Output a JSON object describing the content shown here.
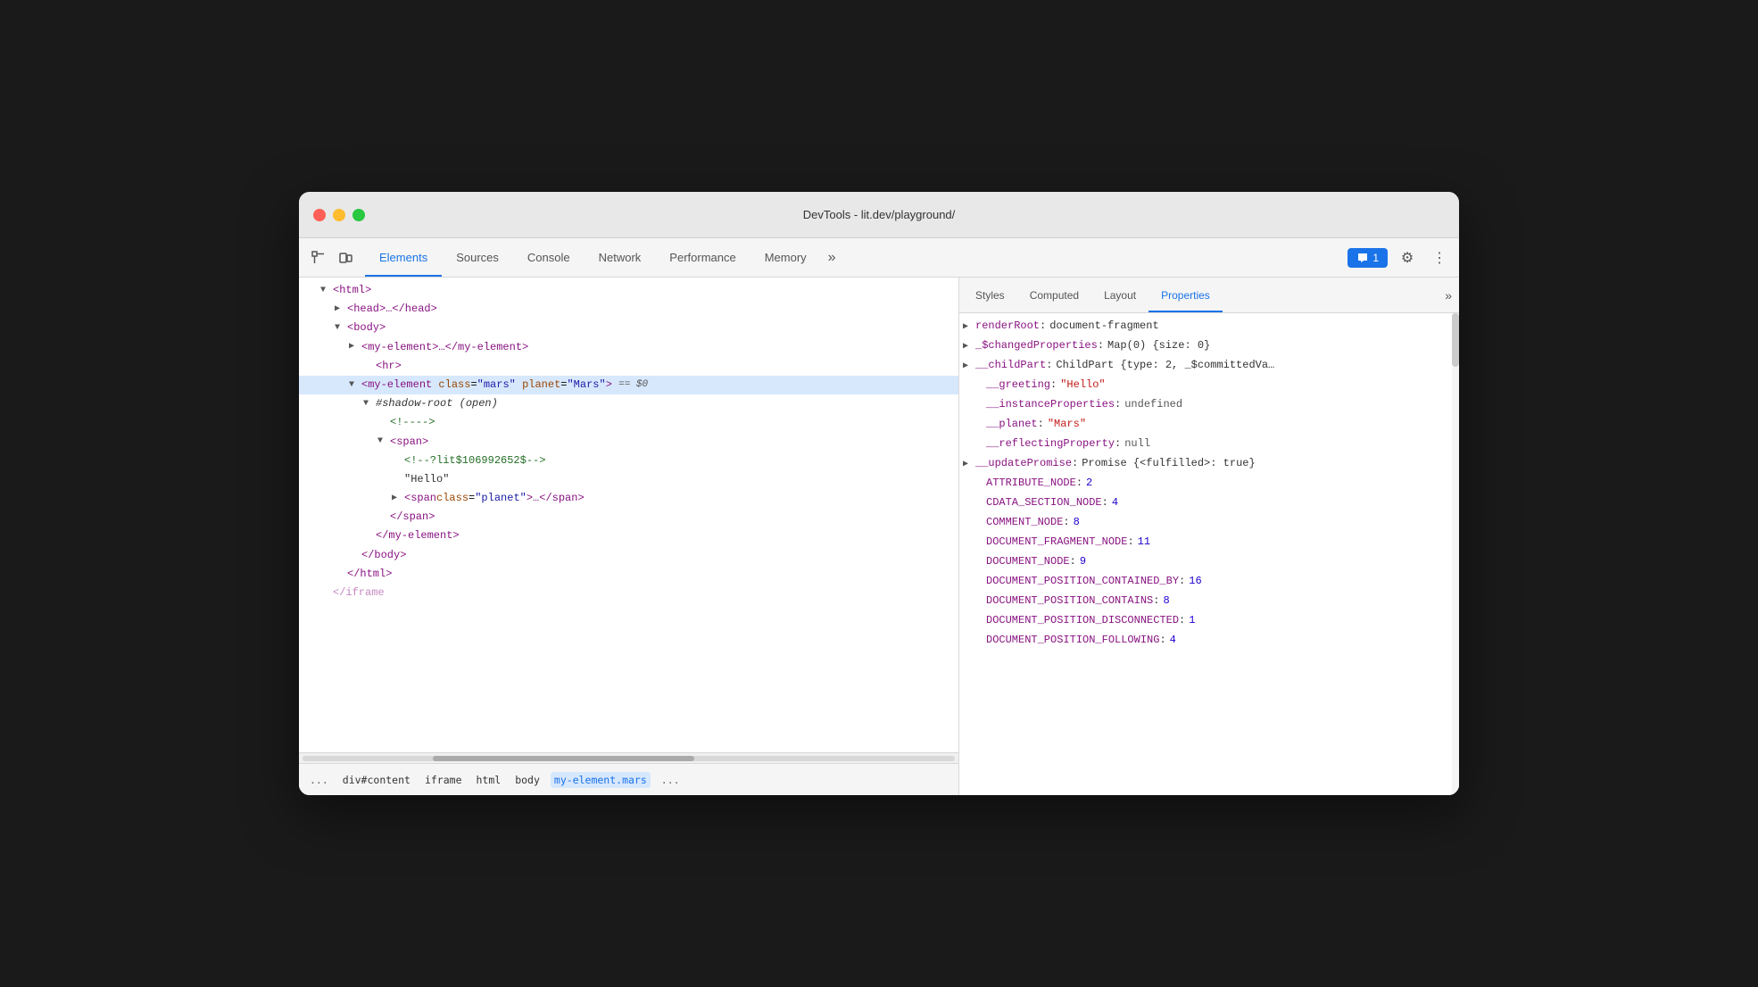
{
  "window": {
    "title": "DevTools - lit.dev/playground/"
  },
  "toolbar": {
    "tabs": [
      {
        "id": "elements",
        "label": "Elements",
        "active": true
      },
      {
        "id": "sources",
        "label": "Sources",
        "active": false
      },
      {
        "id": "console",
        "label": "Console",
        "active": false
      },
      {
        "id": "network",
        "label": "Network",
        "active": false
      },
      {
        "id": "performance",
        "label": "Performance",
        "active": false
      },
      {
        "id": "memory",
        "label": "Memory",
        "active": false
      }
    ],
    "more_tabs": "»",
    "chat_label": "1",
    "settings_icon": "⚙",
    "more_icon": "⋮"
  },
  "right_panel": {
    "tabs": [
      {
        "id": "styles",
        "label": "Styles",
        "active": false
      },
      {
        "id": "computed",
        "label": "Computed",
        "active": false
      },
      {
        "id": "layout",
        "label": "Layout",
        "active": false
      },
      {
        "id": "properties",
        "label": "Properties",
        "active": true
      }
    ],
    "more_icon": "»"
  },
  "dom_tree": {
    "lines": [
      {
        "indent": 1,
        "triangle": "▼",
        "content": "<html>",
        "type": "tag",
        "selected": false
      },
      {
        "indent": 2,
        "triangle": "▶",
        "content": "<head>…</head>",
        "type": "tag",
        "selected": false
      },
      {
        "indent": 2,
        "triangle": "▼",
        "content": "<body>",
        "type": "tag",
        "selected": false
      },
      {
        "indent": 3,
        "triangle": "▶",
        "content": "<my-element>…</my-element>",
        "type": "tag",
        "selected": false
      },
      {
        "indent": 4,
        "triangle": "",
        "content": "<hr>",
        "type": "tag",
        "selected": false
      },
      {
        "indent": 3,
        "triangle": "▼",
        "content_parts": true,
        "selected": true,
        "id": "selected-line"
      },
      {
        "indent": 4,
        "triangle": "▼",
        "content": "#shadow-root (open)",
        "type": "shadow",
        "selected": false
      },
      {
        "indent": 5,
        "triangle": "",
        "content": "<!---->",
        "type": "comment",
        "selected": false
      },
      {
        "indent": 5,
        "triangle": "▼",
        "content": "<span>",
        "type": "tag",
        "selected": false
      },
      {
        "indent": 6,
        "triangle": "",
        "content": "<!--?lit$106992652$-->",
        "type": "comment",
        "selected": false
      },
      {
        "indent": 6,
        "triangle": "",
        "content": "\"Hello\"",
        "type": "text",
        "selected": false
      },
      {
        "indent": 6,
        "triangle": "▶",
        "content": "<span class=\"planet\">…</span>",
        "type": "tag",
        "selected": false
      },
      {
        "indent": 5,
        "triangle": "",
        "content": "</span>",
        "type": "tag-close",
        "selected": false
      },
      {
        "indent": 4,
        "triangle": "",
        "content": "</my-element>",
        "type": "tag-close",
        "selected": false
      },
      {
        "indent": 3,
        "triangle": "",
        "content": "</body>",
        "type": "tag-close",
        "selected": false
      },
      {
        "indent": 2,
        "triangle": "",
        "content": "</html>",
        "type": "tag-close",
        "selected": false
      },
      {
        "indent": 1,
        "triangle": "",
        "content": "</iframe>",
        "type": "tag-close-fade",
        "selected": false
      }
    ]
  },
  "selected_element": {
    "tag_open": "<",
    "tag_name": "my-element",
    "attr_class_name": "class",
    "attr_class_val": "\"mars\"",
    "attr_planet_name": "planet",
    "attr_planet_val": "\"Mars\"",
    "tag_close": ">",
    "dollar": "== $0"
  },
  "breadcrumb": {
    "items": [
      {
        "label": "...",
        "active": false
      },
      {
        "label": "div#content",
        "active": false
      },
      {
        "label": "iframe",
        "active": false
      },
      {
        "label": "html",
        "active": false
      },
      {
        "label": "body",
        "active": false
      },
      {
        "label": "my-element.mars",
        "active": true
      }
    ],
    "more": "..."
  },
  "properties": [
    {
      "expandable": true,
      "name": "renderRoot",
      "colon": ":",
      "value": "document-fragment",
      "value_type": "object"
    },
    {
      "expandable": true,
      "name": "_$changedProperties",
      "colon": ":",
      "value": "Map(0) {size: 0}",
      "value_type": "object"
    },
    {
      "expandable": true,
      "name": "__childPart",
      "colon": ":",
      "value": "ChildPart {type: 2, _$committedVa…",
      "value_type": "object"
    },
    {
      "expandable": false,
      "name": "__greeting",
      "colon": ":",
      "value": "\"Hello\"",
      "value_type": "string"
    },
    {
      "expandable": false,
      "name": "__instanceProperties",
      "colon": ":",
      "value": "undefined",
      "value_type": "null-val"
    },
    {
      "expandable": false,
      "name": "__planet",
      "colon": ":",
      "value": "\"Mars\"",
      "value_type": "string"
    },
    {
      "expandable": false,
      "name": "__reflectingProperty",
      "colon": ":",
      "value": "null",
      "value_type": "null-val"
    },
    {
      "expandable": true,
      "name": "__updatePromise",
      "colon": ":",
      "value": "Promise {<fulfilled>: true}",
      "value_type": "object"
    },
    {
      "expandable": false,
      "name": "ATTRIBUTE_NODE",
      "colon": ":",
      "value": "2",
      "value_type": "number"
    },
    {
      "expandable": false,
      "name": "CDATA_SECTION_NODE",
      "colon": ":",
      "value": "4",
      "value_type": "number"
    },
    {
      "expandable": false,
      "name": "COMMENT_NODE",
      "colon": ":",
      "value": "8",
      "value_type": "number"
    },
    {
      "expandable": false,
      "name": "DOCUMENT_FRAGMENT_NODE",
      "colon": ":",
      "value": "11",
      "value_type": "number"
    },
    {
      "expandable": false,
      "name": "DOCUMENT_NODE",
      "colon": ":",
      "value": "9",
      "value_type": "number"
    },
    {
      "expandable": false,
      "name": "DOCUMENT_POSITION_CONTAINED_BY",
      "colon": ":",
      "value": "16",
      "value_type": "number"
    },
    {
      "expandable": false,
      "name": "DOCUMENT_POSITION_CONTAINS",
      "colon": ":",
      "value": "8",
      "value_type": "number"
    },
    {
      "expandable": false,
      "name": "DOCUMENT_POSITION_DISCONNECTED",
      "colon": ":",
      "value": "1",
      "value_type": "number"
    },
    {
      "expandable": false,
      "name": "DOCUMENT_POSITION_FOLLOWING",
      "colon": ":",
      "value": "4",
      "value_type": "number"
    }
  ]
}
